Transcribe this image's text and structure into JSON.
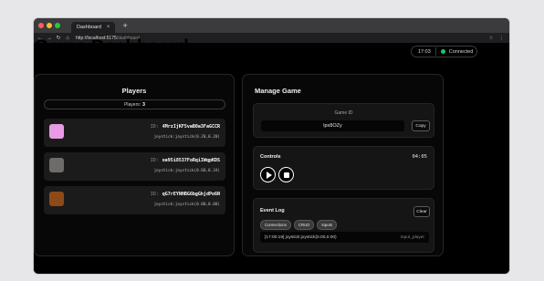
{
  "browser": {
    "tab_title": "Dashboard",
    "tab_close": "×",
    "new_tab": "+",
    "url_host": "http://localhost:5175",
    "url_path": "/dashboard",
    "traffic_colors": [
      "#ff5f57",
      "#febc2e",
      "#28c840"
    ]
  },
  "header": {
    "title": "Game Dashboard",
    "time": "17:03",
    "connection_status": "Connected",
    "connection_color": "#22c55e"
  },
  "players": {
    "title": "Players",
    "count_label": "Players:",
    "count": "3",
    "id_label": "ID:",
    "items": [
      {
        "id": "4MrzIjKF5vaB0a3FaGCCR",
        "state": "joystick:joystick(0.20,0.20)",
        "color": "#e89be4"
      },
      {
        "id": "oe95i8537FoRqiIWqpKDS",
        "state": "joystick:joystick(0.60,0.34)",
        "color": "#6e6c68"
      },
      {
        "id": "qG7rEYNHBG6bgGhjdPo6N",
        "state": "joystick:joystick(0.00,0.00)",
        "color": "#8c4a19"
      }
    ]
  },
  "manage": {
    "title": "Manage Game",
    "game_id_label": "Game ID",
    "game_id": "lpx8OZy",
    "copy_label": "Copy",
    "controls_title": "Controls",
    "timer": "04:05",
    "log_title": "Event Log",
    "clear_label": "Clear",
    "filters": [
      "Connections",
      "CRUD",
      "Inputs"
    ],
    "log_entries": [
      {
        "message": "[17:00:19] joystick:joystick(0.00,0.00)",
        "tag": "input_player"
      }
    ]
  }
}
